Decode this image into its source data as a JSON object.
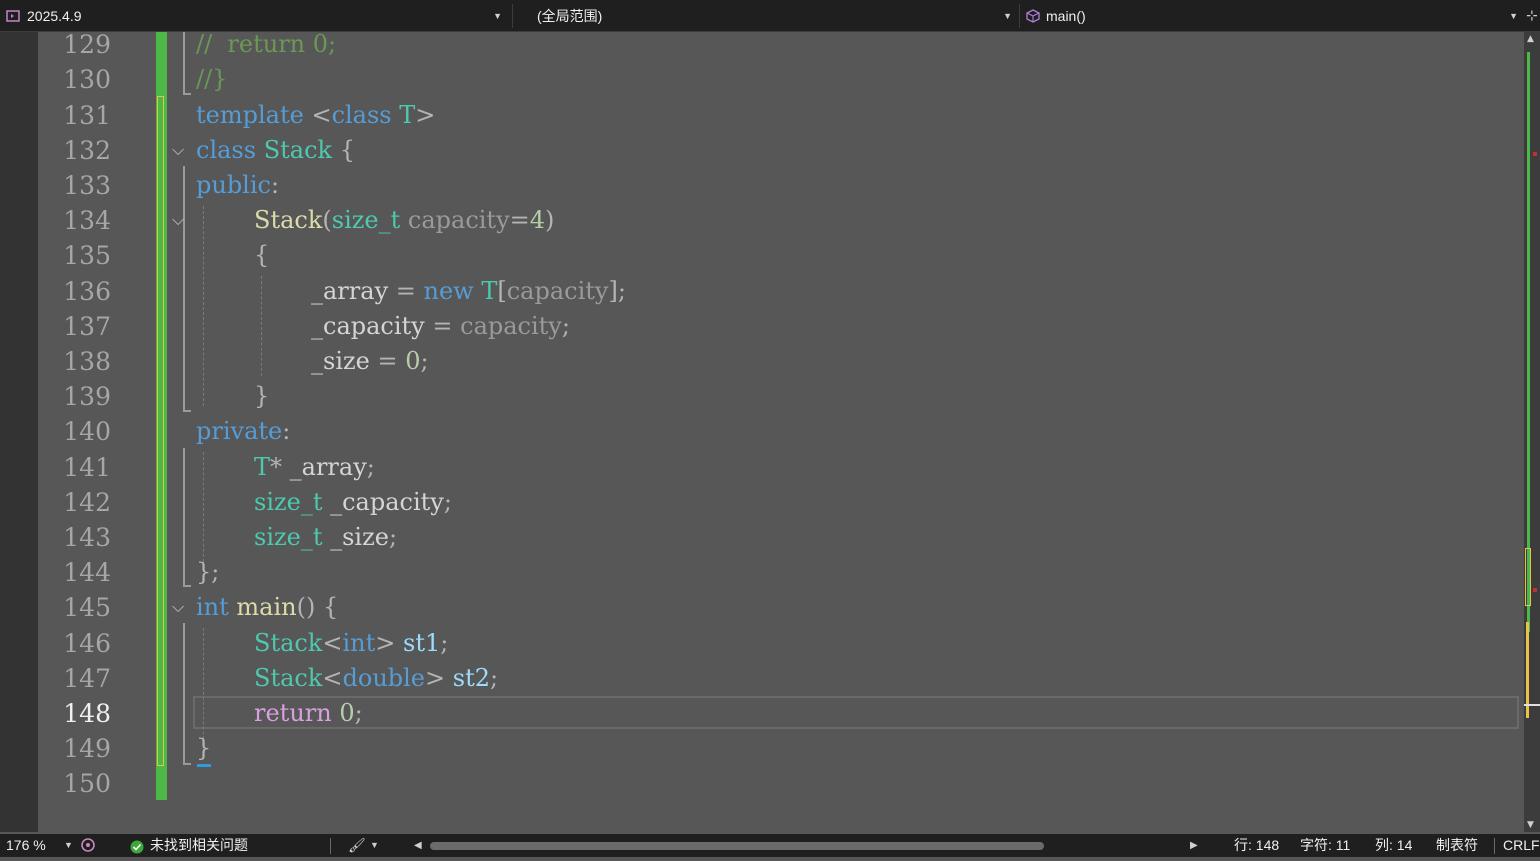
{
  "navbar": {
    "project": "2025.4.9",
    "scope": "(全局范围)",
    "member": "main()"
  },
  "editor": {
    "active_line": 148,
    "lines": [
      {
        "n": "129",
        "text": "//  return 0;"
      },
      {
        "n": "130",
        "text": "//}"
      },
      {
        "n": "131",
        "text": "template <class T>"
      },
      {
        "n": "132",
        "text": "class Stack {"
      },
      {
        "n": "133",
        "text": "public:"
      },
      {
        "n": "134",
        "text": "Stack(size_t capacity=4)"
      },
      {
        "n": "135",
        "text": "{"
      },
      {
        "n": "136",
        "text": "_array = new T[capacity];"
      },
      {
        "n": "137",
        "text": "_capacity = capacity;"
      },
      {
        "n": "138",
        "text": "_size = 0;"
      },
      {
        "n": "139",
        "text": "}"
      },
      {
        "n": "140",
        "text": "private:"
      },
      {
        "n": "141",
        "text": "T* _array;"
      },
      {
        "n": "142",
        "text": "size_t _capacity;"
      },
      {
        "n": "143",
        "text": "size_t _size;"
      },
      {
        "n": "144",
        "text": "};"
      },
      {
        "n": "145",
        "text": "int main() {"
      },
      {
        "n": "146",
        "text": "Stack<int> st1;"
      },
      {
        "n": "147",
        "text": "Stack<double> st2;"
      },
      {
        "n": "148",
        "text": "return 0;"
      },
      {
        "n": "149",
        "text": "}"
      },
      {
        "n": "150",
        "text": ""
      }
    ]
  },
  "statusbar": {
    "zoom": "176 %",
    "issues": "未找到相关问题",
    "line": "行: 148",
    "char": "字符: 11",
    "col": "列: 14",
    "tabs": "制表符",
    "eol": "CRLF"
  },
  "colors": {
    "keyword": "#569cd6",
    "type": "#4ec9b0",
    "comment": "#6a9955",
    "control": "#d8a0df",
    "number": "#b5cea8",
    "function": "#dcdcaa",
    "saved_change": "#4bb848",
    "unsaved_change": "#e8c34a"
  }
}
